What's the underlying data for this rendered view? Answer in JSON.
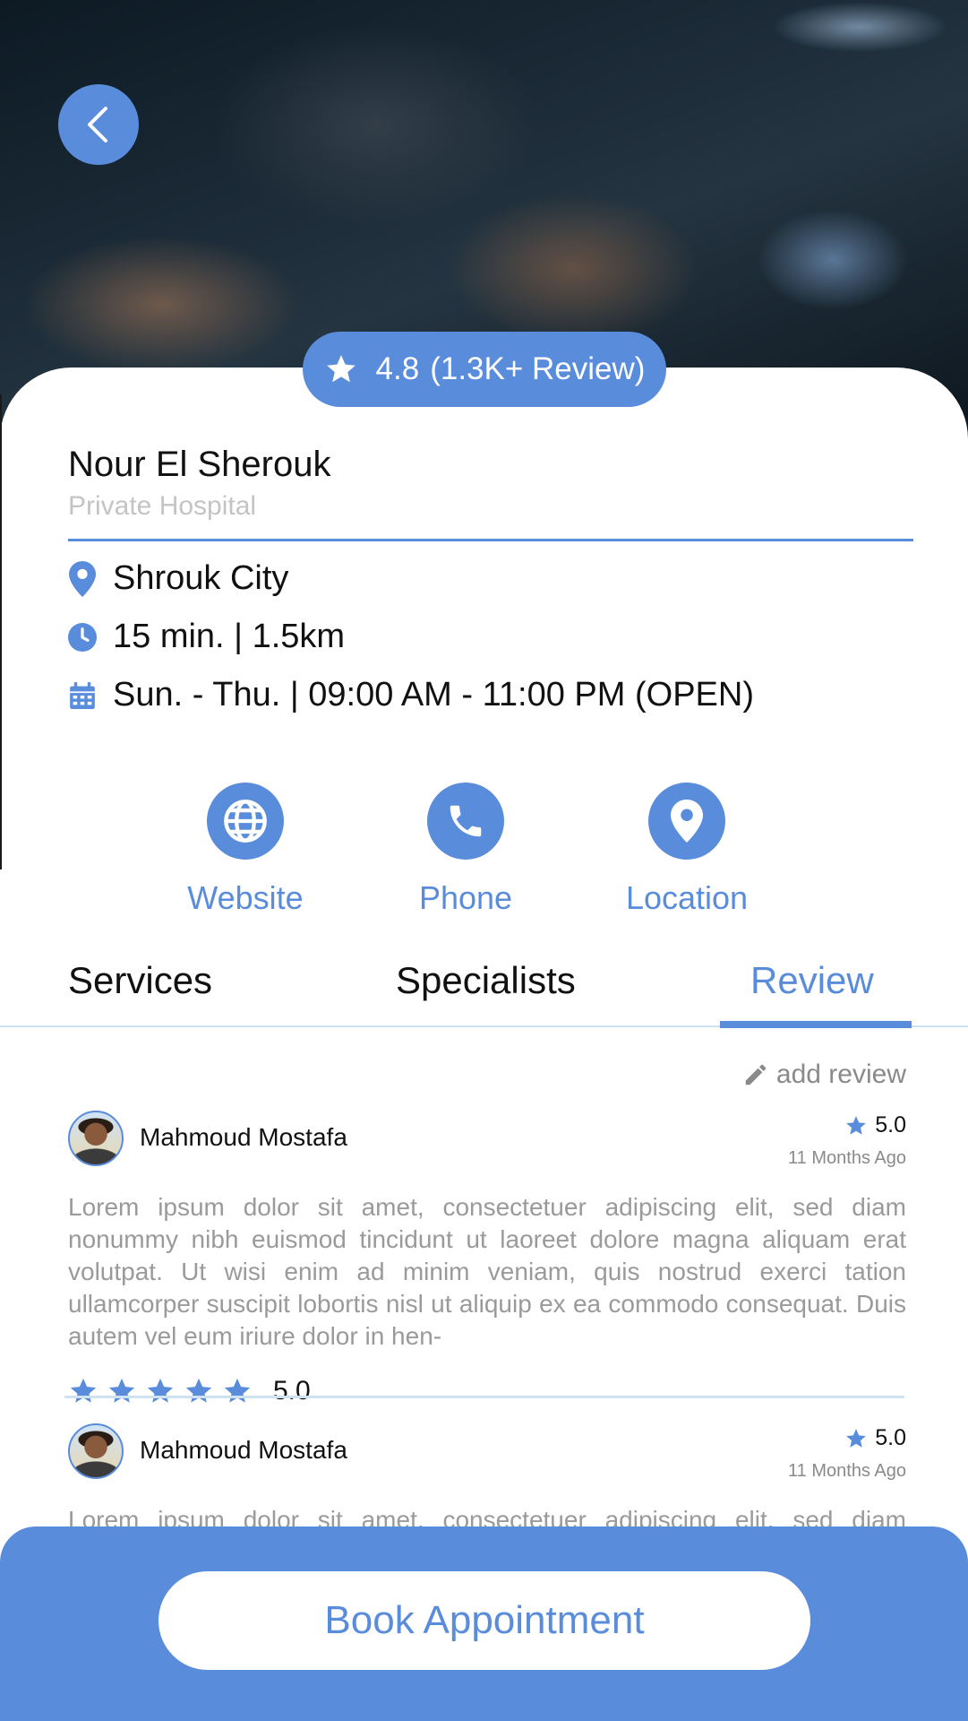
{
  "hospital": {
    "name": "Nour El Sherouk",
    "type": "Private Hospital",
    "rating": "4.8",
    "rating_text": "(1.3K+ Review)"
  },
  "info": {
    "location": "Shrouk City",
    "distance": "15 min. | 1.5km",
    "hours": "Sun. - Thu. | 09:00 AM - 11:00 PM (OPEN)"
  },
  "actions": [
    {
      "label": "Website",
      "icon": "globe-icon"
    },
    {
      "label": "Phone",
      "icon": "phone-icon"
    },
    {
      "label": "Location",
      "icon": "map-pin-icon"
    }
  ],
  "tabs": [
    {
      "label": "Services",
      "active": false
    },
    {
      "label": "Specialists",
      "active": false
    },
    {
      "label": "Review",
      "active": true
    }
  ],
  "reviews_section": {
    "add_review_label": "add review"
  },
  "reviews": [
    {
      "name": "Mahmoud Mostafa",
      "score": "5.0",
      "time_ago": "11 Months Ago",
      "text": "Lorem ipsum dolor sit amet, consectetuer adipiscing elit, sed diam nonummy nibh euismod tincidunt ut laoreet dolore magna aliquam erat volutpat. Ut wisi enim ad minim veniam, quis nostrud exerci tation ullamcorper suscipit lobortis nisl ut aliquip ex ea commodo consequat. Duis autem vel eum iriure dolor in hen-",
      "stars": 5,
      "stars_value": "5.0"
    },
    {
      "name": "Mahmoud Mostafa",
      "score": "5.0",
      "time_ago": "11 Months Ago",
      "text": "Lorem ipsum dolor sit amet, consectetuer adipiscing elit, sed diam nonummy"
    }
  ],
  "cta": {
    "label": "Book Appointment"
  },
  "colors": {
    "accent": "#5a8cdc",
    "muted_text": "#9a9a9a",
    "divider": "#cfe2f2"
  }
}
